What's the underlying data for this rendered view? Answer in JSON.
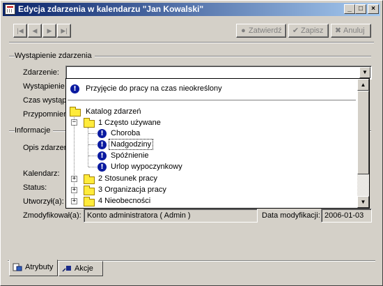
{
  "window": {
    "title": "Edycja zdarzenia w kalendarzu \"Jan Kowalski\"",
    "controls": {
      "minimize": "_",
      "maximize": "□",
      "close": "×"
    }
  },
  "toolbar": {
    "nav": [
      "|◀",
      "◀",
      "▶",
      "▶|"
    ],
    "confirm_label": "Zatwierdź",
    "save_label": "Zapisz",
    "cancel_label": "Anuluj"
  },
  "section_occurrence": {
    "title": "Wystąpienie zdarzenia",
    "event_label": "Zdarzenie:",
    "occurrence_label": "Wystąpienie",
    "duration_label": "Czas wystąp",
    "reminder_label": "Przypomnien"
  },
  "section_info": {
    "title": "Informacje",
    "description_label": "Opis zdarzen",
    "calendar_label": "Kalendarz:",
    "status_label": "Status:",
    "created_label": "Utworzył(a):",
    "modified_by_label": "Zmodyfikował(a):",
    "modified_by_value": "Konto administratora ( Admin )",
    "modified_date_label": "Data modyfikacji:",
    "modified_date_value": "2006-01-03"
  },
  "dropdown": {
    "selected": "Przyjęcie do pracy na czas nieokreślony",
    "tree": {
      "root": "Katalog zdarzeń",
      "groups": [
        {
          "label": "1 Często używane",
          "expanded": true,
          "items": [
            "Choroba",
            "Nadgodziny",
            "Spóźnienie",
            "Urlop wypoczynkowy"
          ],
          "focused": "Nadgodziny"
        },
        {
          "label": "2 Stosunek pracy",
          "expanded": false
        },
        {
          "label": "3 Organizacja pracy",
          "expanded": false
        },
        {
          "label": "4 Nieobecności",
          "expanded": false
        }
      ]
    }
  },
  "tabs": [
    {
      "label": "Atrybuty",
      "active": true
    },
    {
      "label": "Akcje",
      "active": false
    }
  ],
  "icons": {
    "exclamation": "!",
    "check": "✔",
    "cross": "✖",
    "dropdown_arrow": "▼",
    "scroll_up": "▲",
    "scroll_down": "▼",
    "expand": "+",
    "collapse": "−"
  },
  "colors": {
    "title_start": "#0a246a",
    "title_end": "#a6caf0",
    "face": "#d4d0c8",
    "icon_blue": "#0a1aa0"
  }
}
